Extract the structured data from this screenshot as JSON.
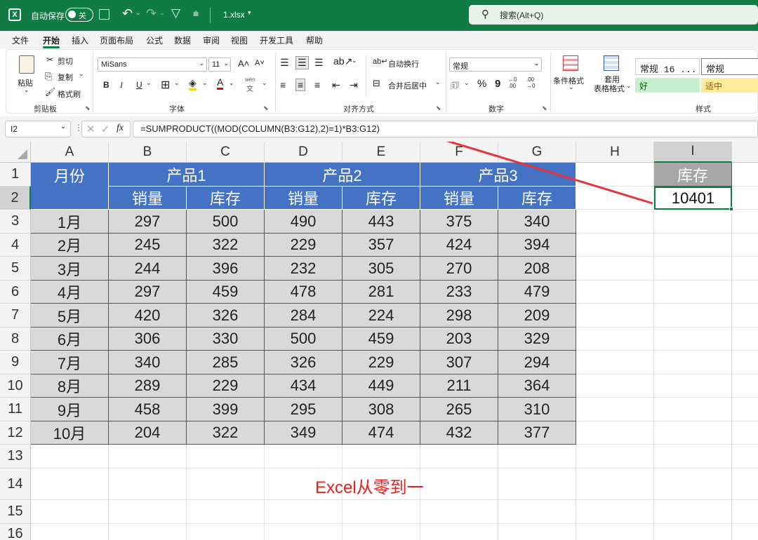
{
  "titlebar": {
    "autosave_label": "自动保存",
    "toggle_state": "关",
    "filename": "1.xlsx",
    "search_placeholder": "搜索(Alt+Q)"
  },
  "menu": [
    "文件",
    "开始",
    "插入",
    "页面布局",
    "公式",
    "数据",
    "审阅",
    "视图",
    "开发工具",
    "帮助"
  ],
  "ribbon": {
    "clipboard": {
      "paste": "粘贴",
      "cut": "剪切",
      "copy": "复制",
      "format_painter": "格式刷",
      "label": "剪贴板"
    },
    "font": {
      "name": "MiSans",
      "size": "11",
      "bold": "B",
      "italic": "I",
      "underline": "U",
      "grow": "A˄",
      "shrink": "A˅",
      "phonetic": "wén",
      "label": "字体"
    },
    "alignment": {
      "wrap": "自动换行",
      "merge": "合并后居中",
      "label": "对齐方式"
    },
    "number": {
      "format": "常规",
      "percent": "%",
      "comma": "9",
      "inc_dec": "←0 .00",
      "dec_dec": ".00 →0",
      "label": "数字"
    },
    "styles": {
      "conditional": "条件格式",
      "table_format_1": "套用",
      "table_format_2": "表格格式",
      "style1": "常规 16 ...",
      "style2": "常规",
      "good": "好",
      "neutral": "适中",
      "label": "样式"
    }
  },
  "formula_bar": {
    "name_box": "I2",
    "fx": "fx",
    "formula": "=SUMPRODUCT((MOD(COLUMN(B3:G12),2)=1)*B3:G12)"
  },
  "sheet": {
    "columns": [
      "A",
      "B",
      "C",
      "D",
      "E",
      "F",
      "G",
      "H",
      "I"
    ],
    "rows": [
      "1",
      "2",
      "3",
      "4",
      "5",
      "6",
      "7",
      "8",
      "9",
      "10",
      "11",
      "12",
      "13",
      "14",
      "15",
      "16"
    ],
    "header": {
      "month": "月份",
      "product1": "产品1",
      "product2": "产品2",
      "product3": "产品3",
      "sales": "销量",
      "stock": "库存"
    },
    "data": [
      [
        "1月",
        "297",
        "500",
        "490",
        "443",
        "375",
        "340"
      ],
      [
        "2月",
        "245",
        "322",
        "229",
        "357",
        "424",
        "394"
      ],
      [
        "3月",
        "244",
        "396",
        "232",
        "305",
        "270",
        "208"
      ],
      [
        "4月",
        "297",
        "459",
        "478",
        "281",
        "233",
        "479"
      ],
      [
        "5月",
        "420",
        "326",
        "284",
        "224",
        "298",
        "209"
      ],
      [
        "6月",
        "306",
        "330",
        "500",
        "459",
        "203",
        "329"
      ],
      [
        "7月",
        "340",
        "285",
        "326",
        "229",
        "307",
        "294"
      ],
      [
        "8月",
        "289",
        "229",
        "434",
        "449",
        "211",
        "364"
      ],
      [
        "9月",
        "458",
        "399",
        "295",
        "308",
        "265",
        "310"
      ],
      [
        "10月",
        "204",
        "322",
        "349",
        "474",
        "432",
        "377"
      ]
    ],
    "result_header": "库存",
    "result_value": "10401",
    "watermark": "Excel从零到一"
  },
  "colors": {
    "title_green": "#107c41",
    "header_blue": "#4472c4",
    "data_gray": "#d9d9d9",
    "result_header_gray": "#a6a6a6",
    "arrow_red": "#e8323c",
    "good_bg": "#c6efce",
    "neutral_bg": "#ffeb9c"
  }
}
